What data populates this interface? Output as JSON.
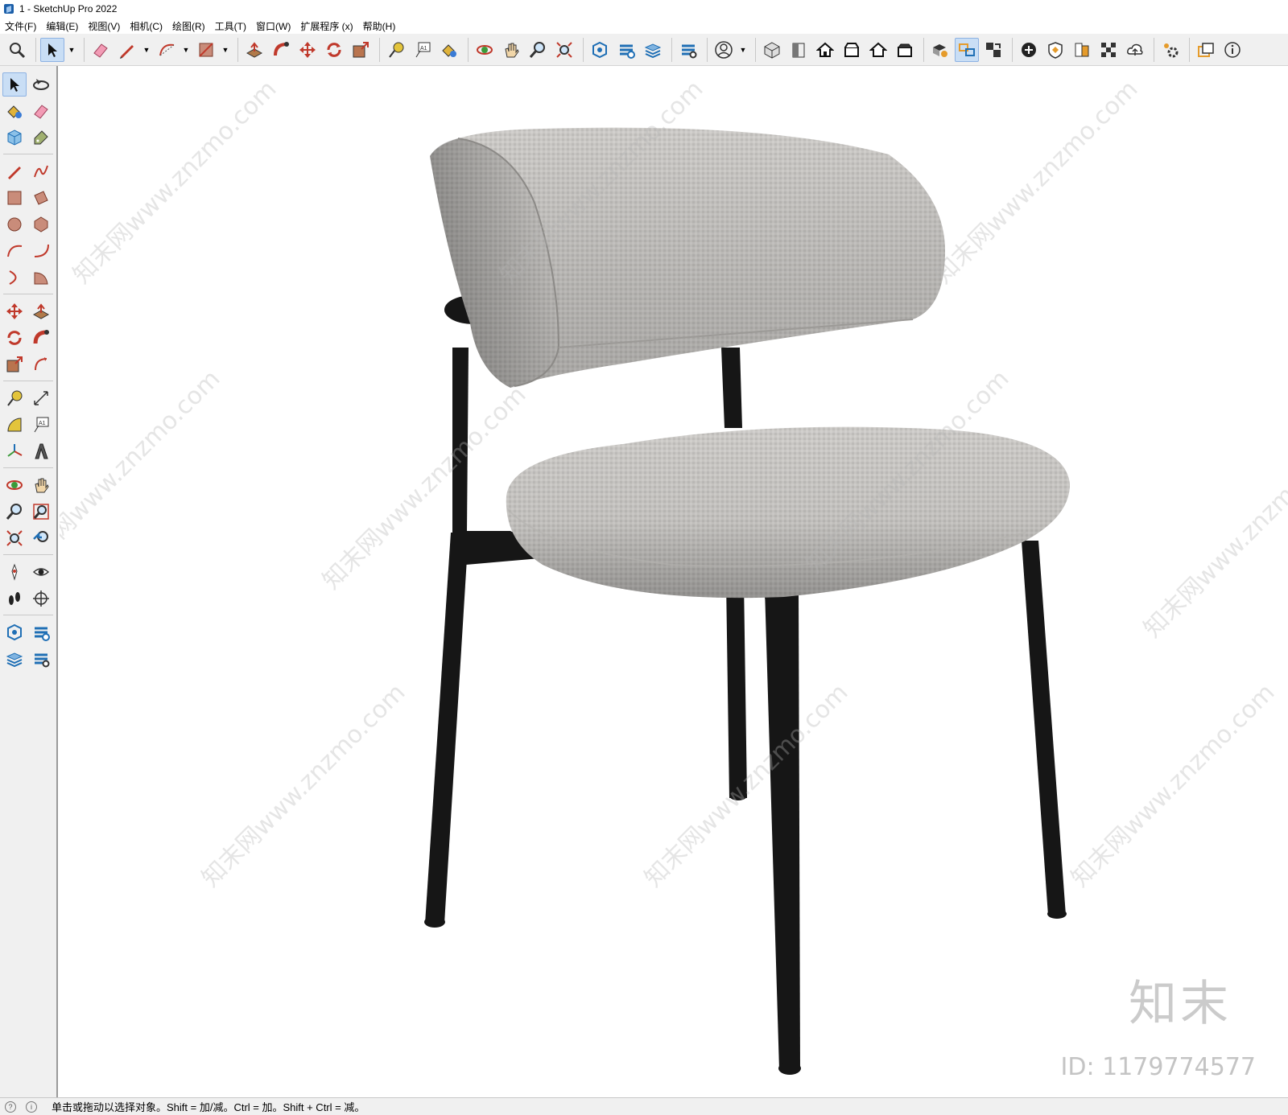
{
  "window": {
    "title": "1 - SketchUp Pro 2022"
  },
  "menu": [
    {
      "label": "文件(F)"
    },
    {
      "label": "编辑(E)"
    },
    {
      "label": "视图(V)"
    },
    {
      "label": "相机(C)"
    },
    {
      "label": "绘图(R)"
    },
    {
      "label": "工具(T)"
    },
    {
      "label": "窗口(W)"
    },
    {
      "label": "扩展程序 (x)"
    },
    {
      "label": "帮助(H)"
    }
  ],
  "toolbar": {
    "icons": [
      "search-icon",
      "select-icon",
      "eraser-icon",
      "pencil-icon",
      "arc-icon",
      "rectangle-icon",
      "pushpull-icon",
      "followme-icon",
      "move-icon",
      "rotate-icon",
      "scale-icon",
      "tape-icon",
      "text-icon",
      "paint-icon",
      "orbit-icon",
      "pan-icon",
      "zoom-icon",
      "zoom-extents-icon",
      "warehouse-icon",
      "extension-icon",
      "layers-icon",
      "settings-icon",
      "user-icon",
      "iso-view-icon",
      "top-view-icon",
      "front-view-icon",
      "right-view-icon",
      "back-view-icon",
      "left-view-icon"
    ]
  },
  "left_tools": [
    [
      "select-tool",
      "orbit-tool"
    ],
    [
      "paint-tool",
      "eraser-tool"
    ],
    [
      "component-tool",
      "tag-tool"
    ],
    [
      "line-tool",
      "freehand-tool"
    ],
    [
      "rectangle-tool",
      "rotated-rect-tool"
    ],
    [
      "circle-tool",
      "polygon-tool"
    ],
    [
      "arc-tool",
      "arc2-tool"
    ],
    [
      "arc3-tool",
      "pie-tool"
    ],
    [
      "move-tool",
      "pushpull-tool"
    ],
    [
      "rotate-tool",
      "followme-tool"
    ],
    [
      "scale-tool",
      "offset-tool"
    ],
    [
      "tape-tool",
      "dimension-tool"
    ],
    [
      "protractor-tool",
      "text-tool"
    ],
    [
      "axes-tool",
      "3dtext-tool"
    ],
    [
      "orbit2-tool",
      "pan-tool"
    ],
    [
      "zoom-tool",
      "zoom-window-tool"
    ],
    [
      "zoom-extents-tool",
      "previous-tool"
    ],
    [
      "position-camera-tool",
      "lookaround-tool"
    ],
    [
      "walk-tool",
      "section-tool"
    ],
    [
      "warehouse-tool",
      "extension-warehouse-tool"
    ],
    [
      "layout-tool",
      "extension-manager-tool"
    ]
  ],
  "colors": {
    "fabric": "#c9c7c4",
    "fabric_dark": "#9d9b98",
    "metal": "#161616",
    "ui_bg": "#f0f0f0"
  },
  "watermark": {
    "text": "知末网www.znzmo.com",
    "logo": "知末",
    "id": "ID: 1179774577"
  },
  "status": {
    "text": "单击或拖动以选择对象。Shift = 加/减。Ctrl = 加。Shift + Ctrl = 减。"
  }
}
